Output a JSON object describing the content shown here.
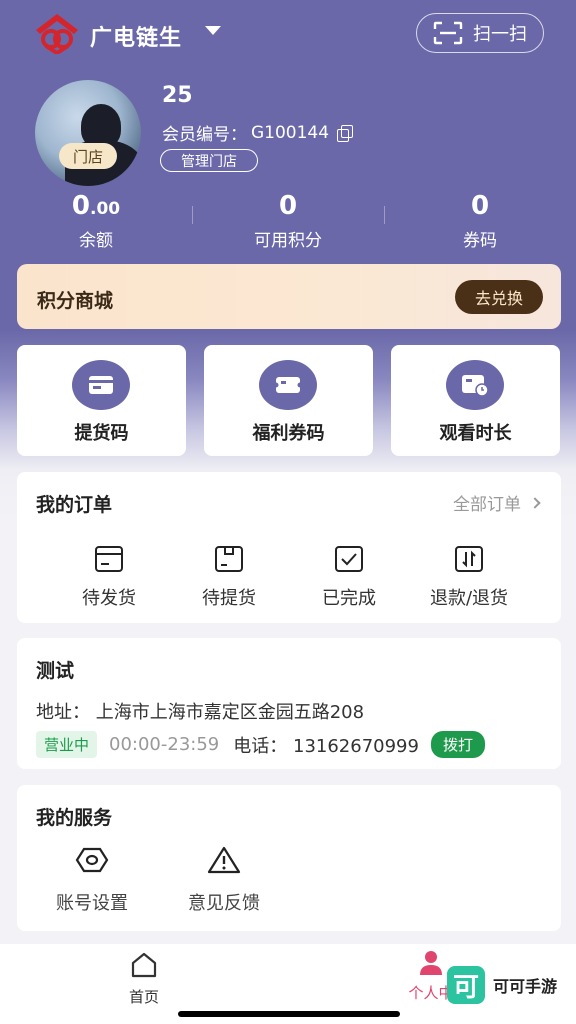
{
  "header": {
    "brand": "广电链生",
    "scan_label": "扫一扫"
  },
  "profile": {
    "name": "25",
    "member_label": "会员编号：",
    "member_id": "G100144",
    "store_tag": "门店",
    "manage_label": "管理门店"
  },
  "stats": [
    {
      "value_int": "0",
      "value_dec": ".00",
      "label": "余额"
    },
    {
      "value_int": "0",
      "value_dec": "",
      "label": "可用积分"
    },
    {
      "value_int": "0",
      "value_dec": "",
      "label": "券码"
    }
  ],
  "mall": {
    "title": "积分商城",
    "button": "去兑换"
  },
  "quick_actions": [
    {
      "label": "提货码",
      "icon": "wallet-icon"
    },
    {
      "label": "福利券码",
      "icon": "coupon-icon"
    },
    {
      "label": "观看时长",
      "icon": "watch-time-icon"
    }
  ],
  "orders": {
    "title": "我的订单",
    "all_label": "全部订单",
    "items": [
      {
        "label": "待发货",
        "icon": "pending-ship-icon"
      },
      {
        "label": "待提货",
        "icon": "pending-pickup-icon"
      },
      {
        "label": "已完成",
        "icon": "completed-icon"
      },
      {
        "label": "退款/退货",
        "icon": "refund-icon"
      }
    ]
  },
  "shop": {
    "name": "测试",
    "address": "地址：  上海市上海市嘉定区金园五路208",
    "status": "营业中",
    "hours": "00:00-23:59",
    "phone": "电话：  13162670999",
    "call_label": "拨打"
  },
  "services": {
    "title": "我的服务",
    "items": [
      {
        "label": "账号设置",
        "icon": "settings-icon"
      },
      {
        "label": "意见反馈",
        "icon": "warning-icon"
      }
    ]
  },
  "tabbar": {
    "home": "首页",
    "me": "个人中"
  },
  "watermark": {
    "logo": "可",
    "text": "可可手游"
  },
  "colors": {
    "primary": "#6a68a8",
    "open_green": "#1e9a4c",
    "mall_button": "#4a3016",
    "active_tab": "#e0466d"
  }
}
